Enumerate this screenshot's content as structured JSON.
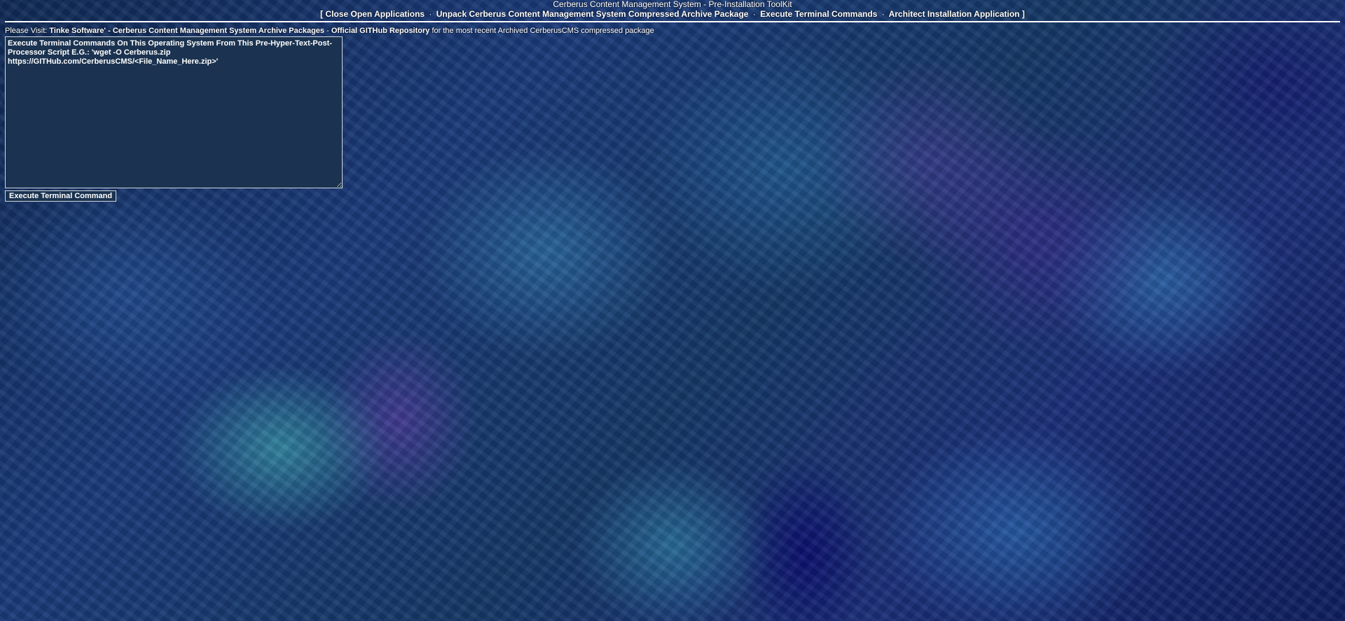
{
  "header": {
    "title": "Cerberus Content Management System - Pre-Installation ToolKit",
    "bracket_open": "[",
    "bracket_close": "]",
    "separator": "·",
    "nav": [
      {
        "label": "Close Open Applications"
      },
      {
        "label": "Unpack Cerberus Content Management System Compressed Archive Package"
      },
      {
        "label": "Execute Terminal Commands"
      },
      {
        "label": "Architect Installation Application"
      }
    ]
  },
  "visit": {
    "prefix": "Please Visit:",
    "link1": "Tinke Software' - Cerberus Content Management System Archive Packages",
    "dash": "-",
    "link2": "Official GITHub Repository",
    "suffix": "for the most recent Archived CerberusCMS compressed package"
  },
  "terminal": {
    "placeholder": "Execute Terminal Commands On This Operating System From This Pre-Hyper-Text-Post-Processor Script E.G.: 'wget -O Cerberus.zip https://GITHub.com/CerberusCMS/<File_Name_Here.zip>'",
    "value": ""
  },
  "execute_button": {
    "label": "Execute Terminal Command"
  },
  "colors": {
    "background": "#1a3a7a",
    "textarea_bg": "#1b3350",
    "text": "#ffffff"
  }
}
